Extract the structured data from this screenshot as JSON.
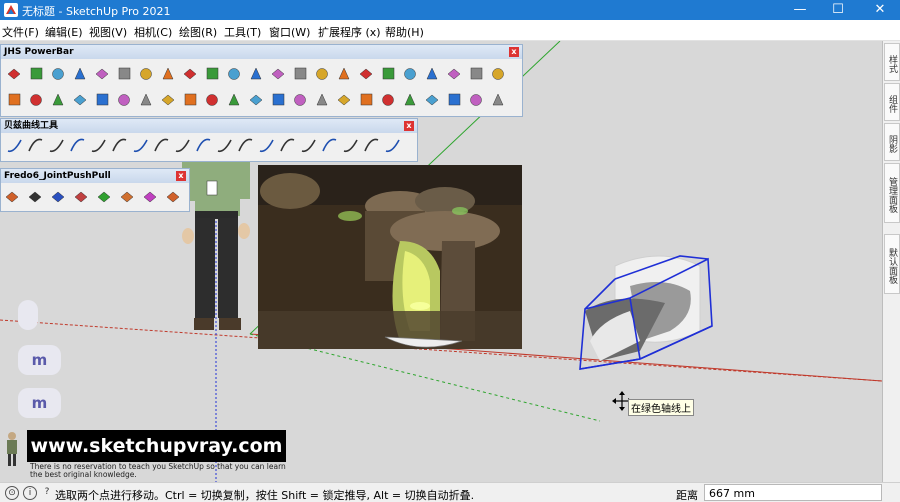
{
  "window": {
    "doc_title": "无标题",
    "separator": " - ",
    "app_title": "SketchUp Pro 2021",
    "min_label": "—",
    "max_label": "☐",
    "close_label": "✕"
  },
  "menu": [
    {
      "label": "文件(F)"
    },
    {
      "label": "编辑(E)"
    },
    {
      "label": "视图(V)"
    },
    {
      "label": "相机(C)"
    },
    {
      "label": "绘图(R)"
    },
    {
      "label": "工具(T)"
    },
    {
      "label": "窗口(W)"
    },
    {
      "label": "扩展程序 (x)"
    },
    {
      "label": "帮助(H)"
    }
  ],
  "toolbars": {
    "powerbar": {
      "title": "JHS PowerBar",
      "close": "x"
    },
    "bezier": {
      "title": "贝兹曲线工具",
      "close": "x"
    },
    "fredo": {
      "title": "Fredo6_JointPushPull",
      "close": "x"
    }
  },
  "right_panel": {
    "tabs": [
      "样式",
      "组件",
      "阴影",
      "管理面板",
      "默认面板"
    ]
  },
  "viewport": {
    "side_buttons": [
      "",
      "m",
      "m"
    ],
    "banner_text": "www.sketchupvray.com",
    "note_line1": "There is no reservation to teach you SketchUp so that you can learn",
    "note_line2": "the best original knowledge.",
    "tooltip": "在绿色轴线上"
  },
  "status": {
    "icon1": "⊙",
    "icon2": "i",
    "icon3": "?",
    "message": "选取两个点进行移动。Ctrl = 切换复制，按住 Shift = 锁定推导, Alt = 切换自动折叠.",
    "distance_label": "距离",
    "distance_value": "667 mm"
  },
  "colors": {
    "titlebar": "#1f7ad1",
    "axis_red": "#c0392b",
    "axis_green": "#2ea52e",
    "selection_blue": "#1f2fd6"
  }
}
